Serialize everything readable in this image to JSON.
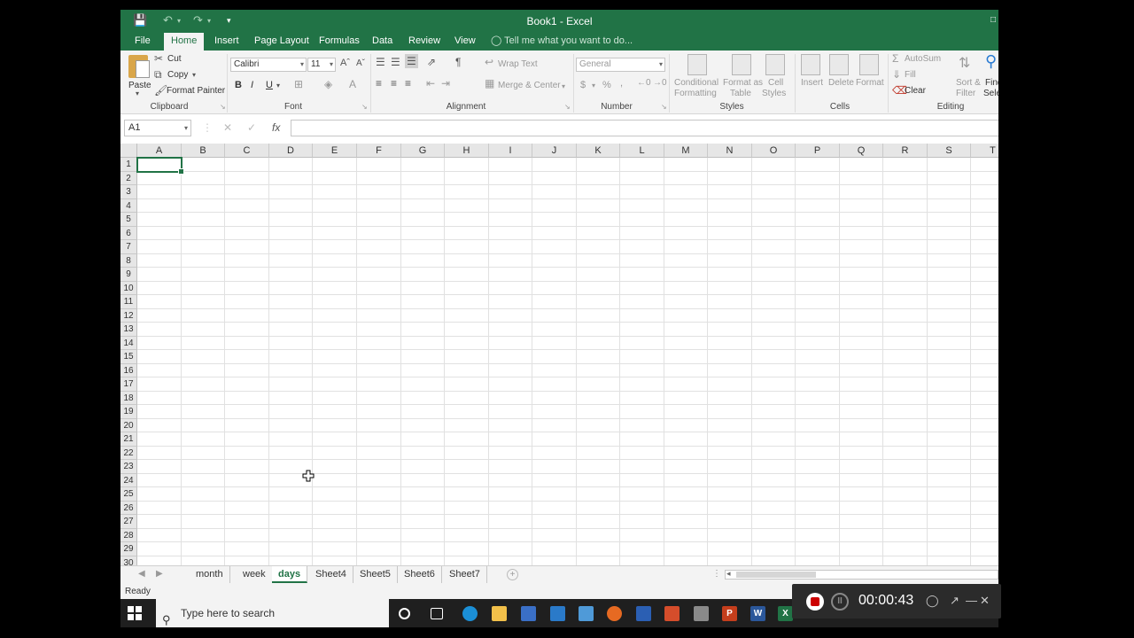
{
  "window": {
    "title": "Book1  -  Excel"
  },
  "tabs": [
    "File",
    "Home",
    "Insert",
    "Page Layout",
    "Formulas",
    "Data",
    "Review",
    "View"
  ],
  "tell_me": "Tell me what you want to do...",
  "ribbon": {
    "clipboard": {
      "label": "Clipboard",
      "paste": "Paste",
      "cut": "Cut",
      "copy": "Copy",
      "format_painter": "Format Painter"
    },
    "font": {
      "label": "Font",
      "font_name": "Calibri",
      "font_size": "11",
      "bold": "B",
      "italic": "I",
      "underline": "U"
    },
    "alignment": {
      "label": "Alignment",
      "wrap_text": "Wrap Text",
      "merge_center": "Merge & Center"
    },
    "number": {
      "label": "Number",
      "format": "General",
      "currency": "$",
      "percent": "%",
      "comma": ","
    },
    "styles": {
      "label": "Styles",
      "conditional_1": "Conditional",
      "conditional_2": "Formatting",
      "format_table_1": "Format as",
      "format_table_2": "Table",
      "cell_styles_1": "Cell",
      "cell_styles_2": "Styles"
    },
    "cells": {
      "label": "Cells",
      "insert": "Insert",
      "delete": "Delete",
      "format": "Format"
    },
    "editing": {
      "label": "Editing",
      "autosum": "AutoSum",
      "fill": "Fill",
      "clear": "Clear",
      "sort_1": "Sort &",
      "sort_2": "Filter",
      "find_1": "Find",
      "find_2": "Sele"
    }
  },
  "formula_bar": {
    "name_box": "A1",
    "fx": "fx",
    "formula": ""
  },
  "columns": [
    "A",
    "B",
    "C",
    "D",
    "E",
    "F",
    "G",
    "H",
    "I",
    "J",
    "K",
    "L",
    "M",
    "N",
    "O",
    "P",
    "Q",
    "R",
    "S",
    "T"
  ],
  "rows": [
    "1",
    "2",
    "3",
    "4",
    "5",
    "6",
    "7",
    "8",
    "9",
    "10",
    "11",
    "12",
    "13",
    "14",
    "15",
    "16",
    "17",
    "18",
    "19",
    "20",
    "21",
    "22",
    "23",
    "24",
    "25",
    "26",
    "27",
    "28",
    "29",
    "30"
  ],
  "selected_cell": "A1",
  "sheets": [
    "month",
    "week",
    "days",
    "Sheet4",
    "Sheet5",
    "Sheet6",
    "Sheet7"
  ],
  "active_sheet": "days",
  "status": "Ready",
  "taskbar": {
    "search_placeholder": "Type here to search"
  },
  "recorder": {
    "elapsed": "00:00:43"
  },
  "colors": {
    "accent": "#217346",
    "record": "#cc0000"
  }
}
